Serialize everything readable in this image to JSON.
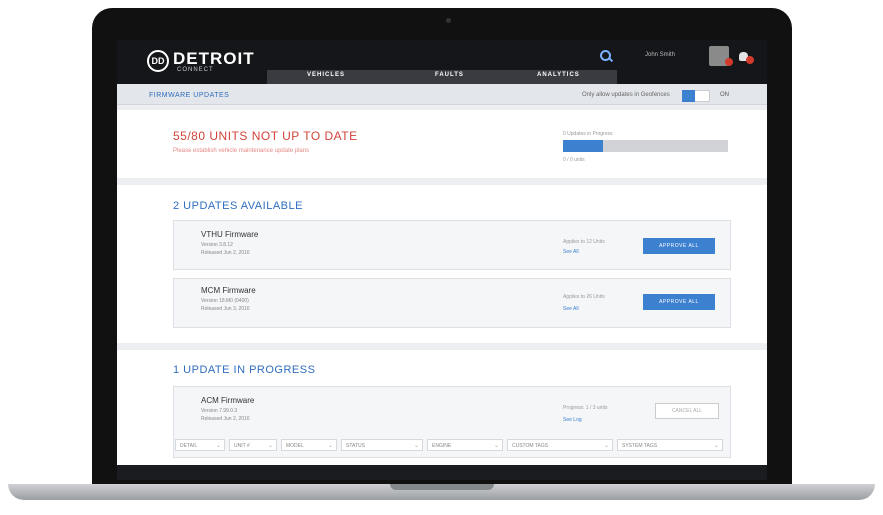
{
  "brand": {
    "name": "DETROIT",
    "sub": "CONNECT"
  },
  "header": {
    "user_name": "John Smith",
    "tabs": [
      {
        "label": "VEHICLES"
      },
      {
        "label": "FAULTS"
      },
      {
        "label": "ANALYTICS"
      }
    ]
  },
  "subheader": {
    "title": "FIRMWARE UPDATES",
    "toggle_label": "Only allow updates in Geofences",
    "toggle_state": "ON"
  },
  "status": {
    "title": "55/80 UNITS NOT UP TO DATE",
    "subtitle": "Please establish vehicle maintenance update plans",
    "progress_label": "0 Updates in Progress",
    "progress_note": "0 / 0 units",
    "progress_fraction": 0.24
  },
  "available": {
    "title": "2 UPDATES AVAILABLE",
    "items": [
      {
        "name": "VTHU Firmware",
        "version": "Version 3.8.12",
        "released": "Released Jun 2, 2016",
        "applies": "Applies to 12 Units",
        "see_all": "See All",
        "action": "APPROVE ALL"
      },
      {
        "name": "MCM Firmware",
        "version": "Version 18.M0 (0400)",
        "released": "Released Jun 3, 2016",
        "applies": "Applies to 26 Units",
        "see_all": "See All",
        "action": "APPROVE ALL"
      }
    ]
  },
  "in_progress": {
    "title": "1 UPDATE IN PROGRESS",
    "items": [
      {
        "name": "ACM Firmware",
        "version": "Version 7.99.0.3",
        "released": "Released Jun 2, 2016",
        "progress": "Progress: 1 / 3 units",
        "see_log": "See Log",
        "action": "CANCEL ALL"
      }
    ]
  },
  "filters": [
    "DETAIL",
    "UNIT #",
    "MODEL",
    "STATUS",
    "ENGINE",
    "CUSTOM TAGS",
    "SYSTEM TAGS"
  ],
  "colors": {
    "accent": "#3c80d0",
    "alert": "#d0443a",
    "topbar": "#15161a"
  }
}
